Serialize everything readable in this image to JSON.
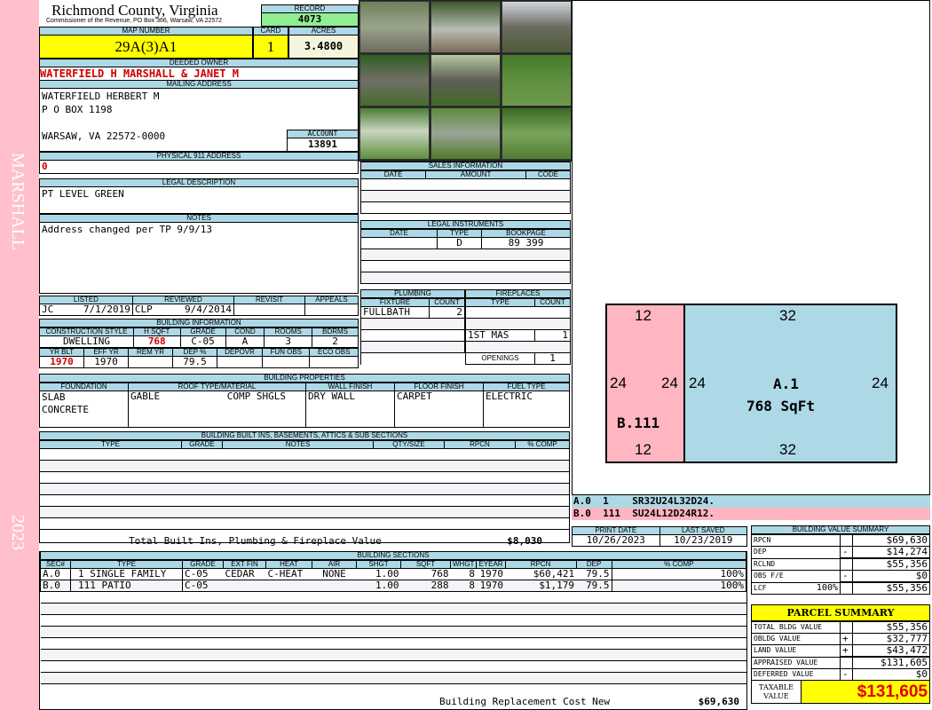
{
  "side": {
    "name": "MARSHALL",
    "year": "2023"
  },
  "header": {
    "county": "Richmond County, Virginia",
    "subtitle": "Commissioner of the Revenue, PO Box 366, Warsaw, VA 22572",
    "record_label": "RECORD",
    "record": "4073"
  },
  "parcel": {
    "map_label": "MAP NUMBER",
    "map": "29A(3)A1",
    "card_label": "CARD",
    "card": "1",
    "acres_label": "ACRES",
    "acres": "3.4800"
  },
  "owner": {
    "label": "DEEDED OWNER",
    "value": "WATERFIELD H MARSHALL & JANET M"
  },
  "mailing": {
    "label": "MAILING ADDRESS",
    "line1": "WATERFIELD HERBERT M",
    "line2": "P O BOX 1198",
    "line3": "WARSAW, VA 22572-0000",
    "account_label": "ACCOUNT",
    "account": "13891"
  },
  "physical": {
    "label": "PHYSICAL 911 ADDRESS",
    "value": "0"
  },
  "legal": {
    "label": "LEGAL DESCRIPTION",
    "value": "PT LEVEL GREEN"
  },
  "notes": {
    "label": "NOTES",
    "value": "Address changed per TP 9/9/13"
  },
  "listing": {
    "listed_label": "LISTED",
    "listed_by": "JC",
    "listed_date": "7/1/2019",
    "reviewed_label": "REVIEWED",
    "reviewed_by": "CLP",
    "reviewed_date": "9/4/2014",
    "revisit_label": "REVISIT",
    "appeals_label": "APPEALS"
  },
  "building_info": {
    "label": "BUILDING INFORMATION",
    "headers1": [
      "CONSTRUCTION STYLE",
      "H SQFT",
      "GRADE",
      "COND",
      "ROOMS",
      "BDRMS"
    ],
    "values1": [
      "DWELLING",
      "768",
      "C-05",
      "A",
      "3",
      "2"
    ],
    "headers2": [
      "YR BLT",
      "EFF YR",
      "REM YR",
      "DEP %",
      "DEPOVR",
      "FUN OBS",
      "ECO OBS"
    ],
    "values2": [
      "1970",
      "1970",
      "",
      "79.5",
      "",
      "",
      ""
    ]
  },
  "building_props": {
    "label": "BUILDING PROPERTIES",
    "headers": [
      "FOUNDATION",
      "ROOF TYPE/MATERIAL",
      "WALL FINISH",
      "FLOOR FINISH",
      "FUEL TYPE"
    ],
    "foundation": [
      "SLAB",
      "CONCRETE"
    ],
    "roof_type": "GABLE",
    "roof_material": "COMP SHGLS",
    "wall": "DRY WALL",
    "floor": "CARPET",
    "fuel": "ELECTRIC"
  },
  "built_ins": {
    "label": "BUILDING BUILT INS, BASEMENTS, ATTICS & SUB SECTIONS",
    "headers": [
      "TYPE",
      "GRADE",
      "NOTES",
      "QTY/SIZE",
      "RPCN",
      "% COMP"
    ],
    "total_label": "Total Built Ins, Plumbing & Fireplace Value",
    "total": "$8,030"
  },
  "sales": {
    "label": "SALES INFORMATION",
    "headers": [
      "DATE",
      "AMOUNT",
      "CODE"
    ]
  },
  "instruments": {
    "label": "LEGAL INSTRUMENTS",
    "headers": [
      "DATE",
      "TYPE",
      "BOOKPAGE"
    ],
    "rows": [
      {
        "date": "",
        "type": "D",
        "bookpage": "89 399"
      }
    ]
  },
  "plumbing": {
    "label": "PLUMBING",
    "headers": [
      "FIXTURE",
      "COUNT"
    ],
    "rows": [
      {
        "fixture": "FULLBATH",
        "count": "2"
      }
    ]
  },
  "fireplaces": {
    "label": "FIREPLACES",
    "headers": [
      "TYPE",
      "COUNT"
    ],
    "rows": [
      {
        "type": "1ST MAS",
        "count": "1"
      }
    ],
    "openings_label": "OPENINGS",
    "openings": "1"
  },
  "sketch": {
    "b_top": "12",
    "b_left": "24",
    "b_right": "24",
    "b_label": "B.111",
    "b_bottom": "12",
    "a_top": "32",
    "a_left": "24",
    "a_right": "24",
    "a_label": "A.1",
    "a_area": "768 SqFt",
    "a_bottom": "32"
  },
  "sketch_legend": [
    {
      "sec": "A.0",
      "code": "1",
      "path": "SR32U24L32D24."
    },
    {
      "sec": "B.0",
      "code": "111",
      "path": "SU24L12D24R12."
    }
  ],
  "dates": {
    "print_label": "PRINT DATE",
    "print": "10/26/2023",
    "saved_label": "LAST SAVED",
    "saved": "10/23/2019"
  },
  "sections": {
    "label": "BUILDING SECTIONS",
    "headers": [
      "SEC#",
      "TYPE",
      "GRADE",
      "EXT FIN",
      "HEAT",
      "AIR",
      "SHGT",
      "SQFT",
      "WHGT",
      "EYEAR",
      "RPCN",
      "DEP",
      "% COMP"
    ],
    "rows": [
      [
        "A.0",
        "1 SINGLE FAMILY",
        "C-05",
        "CEDAR",
        "C-HEAT",
        "NONE",
        "1.00",
        "768",
        "8",
        "1970",
        "$60,421",
        "79.5",
        "100%"
      ],
      [
        "B.0",
        "111 PATIO",
        "C-05",
        "",
        "",
        "",
        "1.00",
        "288",
        "8",
        "1970",
        "$1,179",
        "79.5",
        "100%"
      ]
    ],
    "total_label": "Building Replacement Cost New",
    "total": "$69,630"
  },
  "value_summary": {
    "label": "BUILDING VALUE SUMMARY",
    "rpcn_label": "RPCN",
    "rpcn": "$69,630",
    "dep_label": "DEP",
    "dep_sign": "-",
    "dep": "$14,274",
    "rclnd_label": "RCLND",
    "rclnd": "$55,356",
    "obs_label": "OBS F/E",
    "obs_sign": "-",
    "obs": "$0",
    "lcf_label": "LCF",
    "lcf_pct": "100%",
    "lcf": "$55,356"
  },
  "parcel_summary": {
    "label": "PARCEL SUMMARY",
    "total_bldg_label": "TOTAL BLDG VALUE",
    "total_bldg": "$55,356",
    "obldg_label": "OBLDG VALUE",
    "obldg_sign": "+",
    "obldg": "$32,777",
    "land_label": "LAND VALUE",
    "land_sign": "+",
    "land": "$43,472",
    "appraised_label": "APPRAISED VALUE",
    "appraised": "$131,605",
    "deferred_label": "DEFERRED VALUE",
    "deferred_sign": "-",
    "deferred": "$0",
    "taxable_label": "TAXABLE VALUE",
    "taxable": "$131,605"
  }
}
